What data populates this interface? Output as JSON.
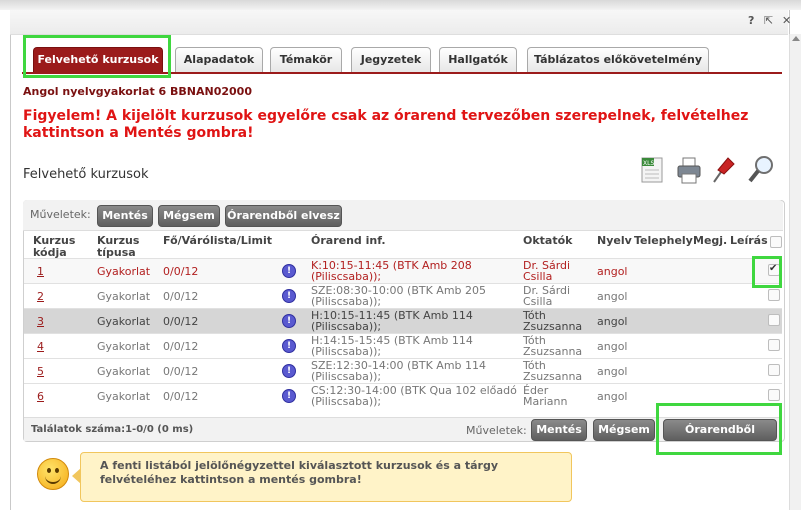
{
  "window": {
    "help": "?",
    "restore": "⇱",
    "close": "✕"
  },
  "tabs": [
    {
      "label": "Felvehető kurzusok"
    },
    {
      "label": "Alapadatok"
    },
    {
      "label": "Témakör"
    },
    {
      "label": "Jegyzetek"
    },
    {
      "label": "Hallgatók"
    },
    {
      "label": "Táblázatos előkövetelmény"
    }
  ],
  "subject": "Angol nyelvgyakorlat 6 BBNAN02000",
  "warning": "Figyelem! A kijelölt kurzusok egyelőre csak az órarend tervezőben szerepelnek, felvételhez kattintson a Mentés gombra!",
  "section_title": "Felvehető kurzusok",
  "toolbar_icons": [
    "excel-export-icon",
    "print-icon",
    "pin-icon",
    "search-icon"
  ],
  "operations": {
    "label": "Műveletek:",
    "save": "Mentés",
    "cancel": "Mégsem",
    "remove": "Órarendből elvesz"
  },
  "columns": {
    "code": "Kurzus kódja",
    "type": "Kurzus típusa",
    "limit": "Fő/Várólista/Limit",
    "schedule": "Órarend inf.",
    "teachers": "Oktatók",
    "lang": "Nyelv",
    "site": "Telephely",
    "note": "Megj.",
    "desc": "Leírás"
  },
  "rows": [
    {
      "code": "1",
      "type": "Gyakorlat",
      "limit": "0/0/12",
      "schedule": "K:10:15-11:45 (BTK Amb 208 (Piliscsaba));",
      "teacher": "Dr. Sárdi Csilla",
      "lang": "angol",
      "checked": true
    },
    {
      "code": "2",
      "type": "Gyakorlat",
      "limit": "0/0/12",
      "schedule": "SZE:08:30-10:00 (BTK Amb 205 (Piliscsaba));",
      "teacher": "Dr. Sárdi Csilla",
      "lang": "angol",
      "checked": false
    },
    {
      "code": "3",
      "type": "Gyakorlat",
      "limit": "0/0/12",
      "schedule": "H:10:15-11:45 (BTK Amb 114 (Piliscsaba));",
      "teacher": "Tóth Zsuzsanna",
      "lang": "angol",
      "checked": false
    },
    {
      "code": "4",
      "type": "Gyakorlat",
      "limit": "0/0/12",
      "schedule": "H:14:15-15:45 (BTK Amb 114 (Piliscsaba));",
      "teacher": "Tóth Zsuzsanna",
      "lang": "angol",
      "checked": false
    },
    {
      "code": "5",
      "type": "Gyakorlat",
      "limit": "0/0/12",
      "schedule": "SZE:12:30-14:00 (BTK Amb 114 (Piliscsaba));",
      "teacher": "Tóth Zsuzsanna",
      "lang": "angol",
      "checked": false
    },
    {
      "code": "6",
      "type": "Gyakorlat",
      "limit": "0/0/12",
      "schedule": "CS:12:30-14:00 (BTK Qua 102 előadó (Piliscsaba));",
      "teacher": "Éder Mariann",
      "lang": "angol",
      "checked": false
    }
  ],
  "results": "Találatok száma:1-0/0 (0 ms)",
  "hint": "A fenti listából jelölőnégyzettel kiválasztott kurzusok és a tárgy felvételéhez kattintson a mentés gombra!"
}
